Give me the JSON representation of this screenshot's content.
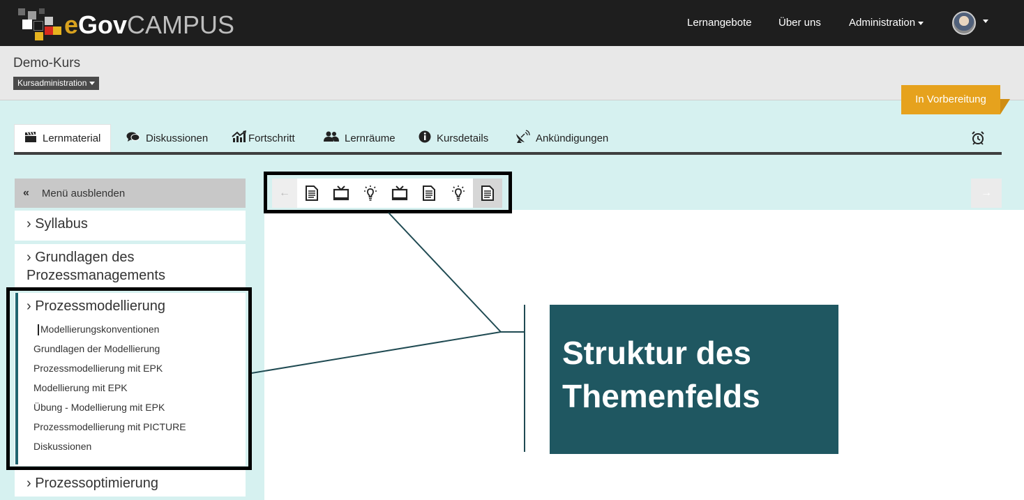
{
  "brand": {
    "name_e": "e",
    "name_gov": "Gov",
    "name_campus": "CAMPUS"
  },
  "topnav": {
    "items": [
      {
        "label": "Lernangebote"
      },
      {
        "label": "Über uns"
      },
      {
        "label": "Administration"
      }
    ]
  },
  "course": {
    "title": "Demo-Kurs",
    "admin_label": "Kursadministration",
    "status_badge": "In Vorbereitung"
  },
  "tabs": [
    {
      "label": "Lernmaterial",
      "icon": "clapperboard-icon"
    },
    {
      "label": "Diskussionen",
      "icon": "comments-icon"
    },
    {
      "label": "Fortschritt",
      "icon": "chart-icon"
    },
    {
      "label": "Lernräume",
      "icon": "users-icon"
    },
    {
      "label": "Kursdetails",
      "icon": "info-icon"
    },
    {
      "label": "Ankündigungen",
      "icon": "satellite-dish-icon"
    }
  ],
  "sidebar": {
    "toggle_label": "Menü ausblenden",
    "sections": [
      {
        "label": "› Syllabus"
      },
      {
        "label": "› Grundlagen des Prozessmanagements"
      },
      {
        "label": "› Prozessmodellierung"
      },
      {
        "label": "› Prozessoptimierung"
      }
    ],
    "subitems": [
      {
        "label": "Modellierungskonventionen"
      },
      {
        "label": "Grundlagen der Modellierung"
      },
      {
        "label": "Prozessmodellierung mit EPK"
      },
      {
        "label": "Modellierung mit EPK"
      },
      {
        "label": "Übung - Modellierung mit EPK"
      },
      {
        "label": "Prozessmodellierung mit PICTURE"
      },
      {
        "label": "Diskussionen"
      }
    ]
  },
  "item_bar": {
    "items": [
      "document-icon",
      "video-icon",
      "lightbulb-icon",
      "video-icon",
      "document-icon",
      "lightbulb-icon",
      "document-icon"
    ],
    "current_index": 6
  },
  "annotation": {
    "callout_line1": "Struktur des",
    "callout_line2": "Themenfelds"
  },
  "colors": {
    "accent": "#e6a21d",
    "teal": "#1f5761",
    "panel": "#d6f1f0"
  }
}
